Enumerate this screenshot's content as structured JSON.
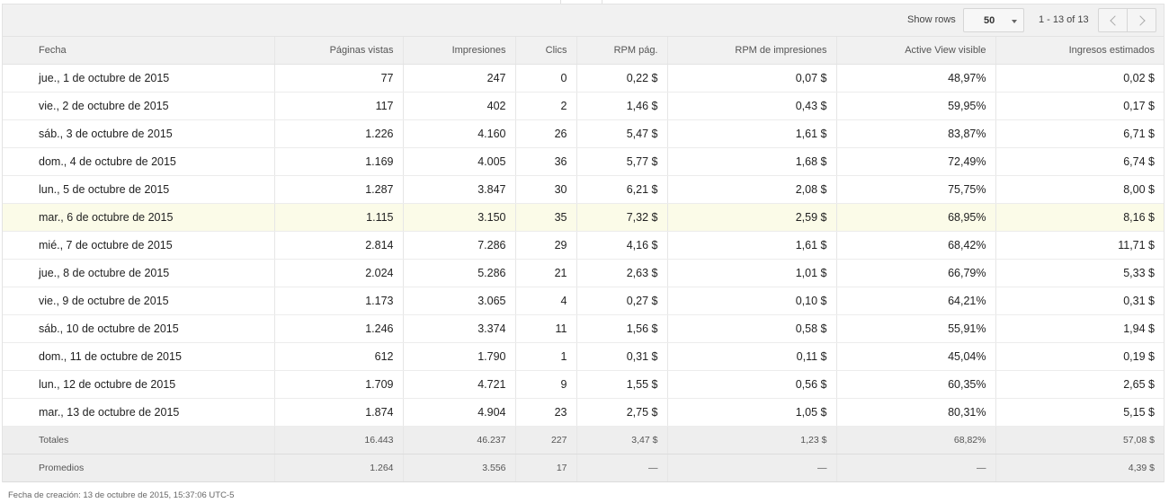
{
  "toolbar": {
    "show_rows_label": "Show rows",
    "rows_value": "50",
    "pager_text": "1 - 13 of 13"
  },
  "columns": [
    "Fecha",
    "Páginas vistas",
    "Impresiones",
    "Clics",
    "RPM pág.",
    "RPM de impresiones",
    "Active View visible",
    "Ingresos estimados"
  ],
  "rows": [
    [
      "jue., 1 de octubre de 2015",
      "77",
      "247",
      "0",
      "0,22 $",
      "0,07 $",
      "48,97%",
      "0,02 $"
    ],
    [
      "vie., 2 de octubre de 2015",
      "117",
      "402",
      "2",
      "1,46 $",
      "0,43 $",
      "59,95%",
      "0,17 $"
    ],
    [
      "sáb., 3 de octubre de 2015",
      "1.226",
      "4.160",
      "26",
      "5,47 $",
      "1,61 $",
      "83,87%",
      "6,71 $"
    ],
    [
      "dom., 4 de octubre de 2015",
      "1.169",
      "4.005",
      "36",
      "5,77 $",
      "1,68 $",
      "72,49%",
      "6,74 $"
    ],
    [
      "lun., 5 de octubre de 2015",
      "1.287",
      "3.847",
      "30",
      "6,21 $",
      "2,08 $",
      "75,75%",
      "8,00 $"
    ],
    [
      "mar., 6 de octubre de 2015",
      "1.115",
      "3.150",
      "35",
      "7,32 $",
      "2,59 $",
      "68,95%",
      "8,16 $"
    ],
    [
      "mié., 7 de octubre de 2015",
      "2.814",
      "7.286",
      "29",
      "4,16 $",
      "1,61 $",
      "68,42%",
      "11,71 $"
    ],
    [
      "jue., 8 de octubre de 2015",
      "2.024",
      "5.286",
      "21",
      "2,63 $",
      "1,01 $",
      "66,79%",
      "5,33 $"
    ],
    [
      "vie., 9 de octubre de 2015",
      "1.173",
      "3.065",
      "4",
      "0,27 $",
      "0,10 $",
      "64,21%",
      "0,31 $"
    ],
    [
      "sáb., 10 de octubre de 2015",
      "1.246",
      "3.374",
      "11",
      "1,56 $",
      "0,58 $",
      "55,91%",
      "1,94 $"
    ],
    [
      "dom., 11 de octubre de 2015",
      "612",
      "1.790",
      "1",
      "0,31 $",
      "0,11 $",
      "45,04%",
      "0,19 $"
    ],
    [
      "lun., 12 de octubre de 2015",
      "1.709",
      "4.721",
      "9",
      "1,55 $",
      "0,56 $",
      "60,35%",
      "2,65 $"
    ],
    [
      "mar., 13 de octubre de 2015",
      "1.874",
      "4.904",
      "23",
      "2,75 $",
      "1,05 $",
      "80,31%",
      "5,15 $"
    ]
  ],
  "totals": [
    "Totales",
    "16.443",
    "46.237",
    "227",
    "3,47 $",
    "1,23 $",
    "68,82%",
    "57,08 $"
  ],
  "averages": [
    "Promedios",
    "1.264",
    "3.556",
    "17",
    "—",
    "—",
    "—",
    "4,39 $"
  ],
  "footer": {
    "creation_text": "Fecha de creación: 13 de octubre de 2015, 15:37:06 UTC-5"
  },
  "icons": {
    "prev": "chevron-left-icon",
    "next": "chevron-right-icon",
    "dropdown": "caret-down-icon"
  }
}
